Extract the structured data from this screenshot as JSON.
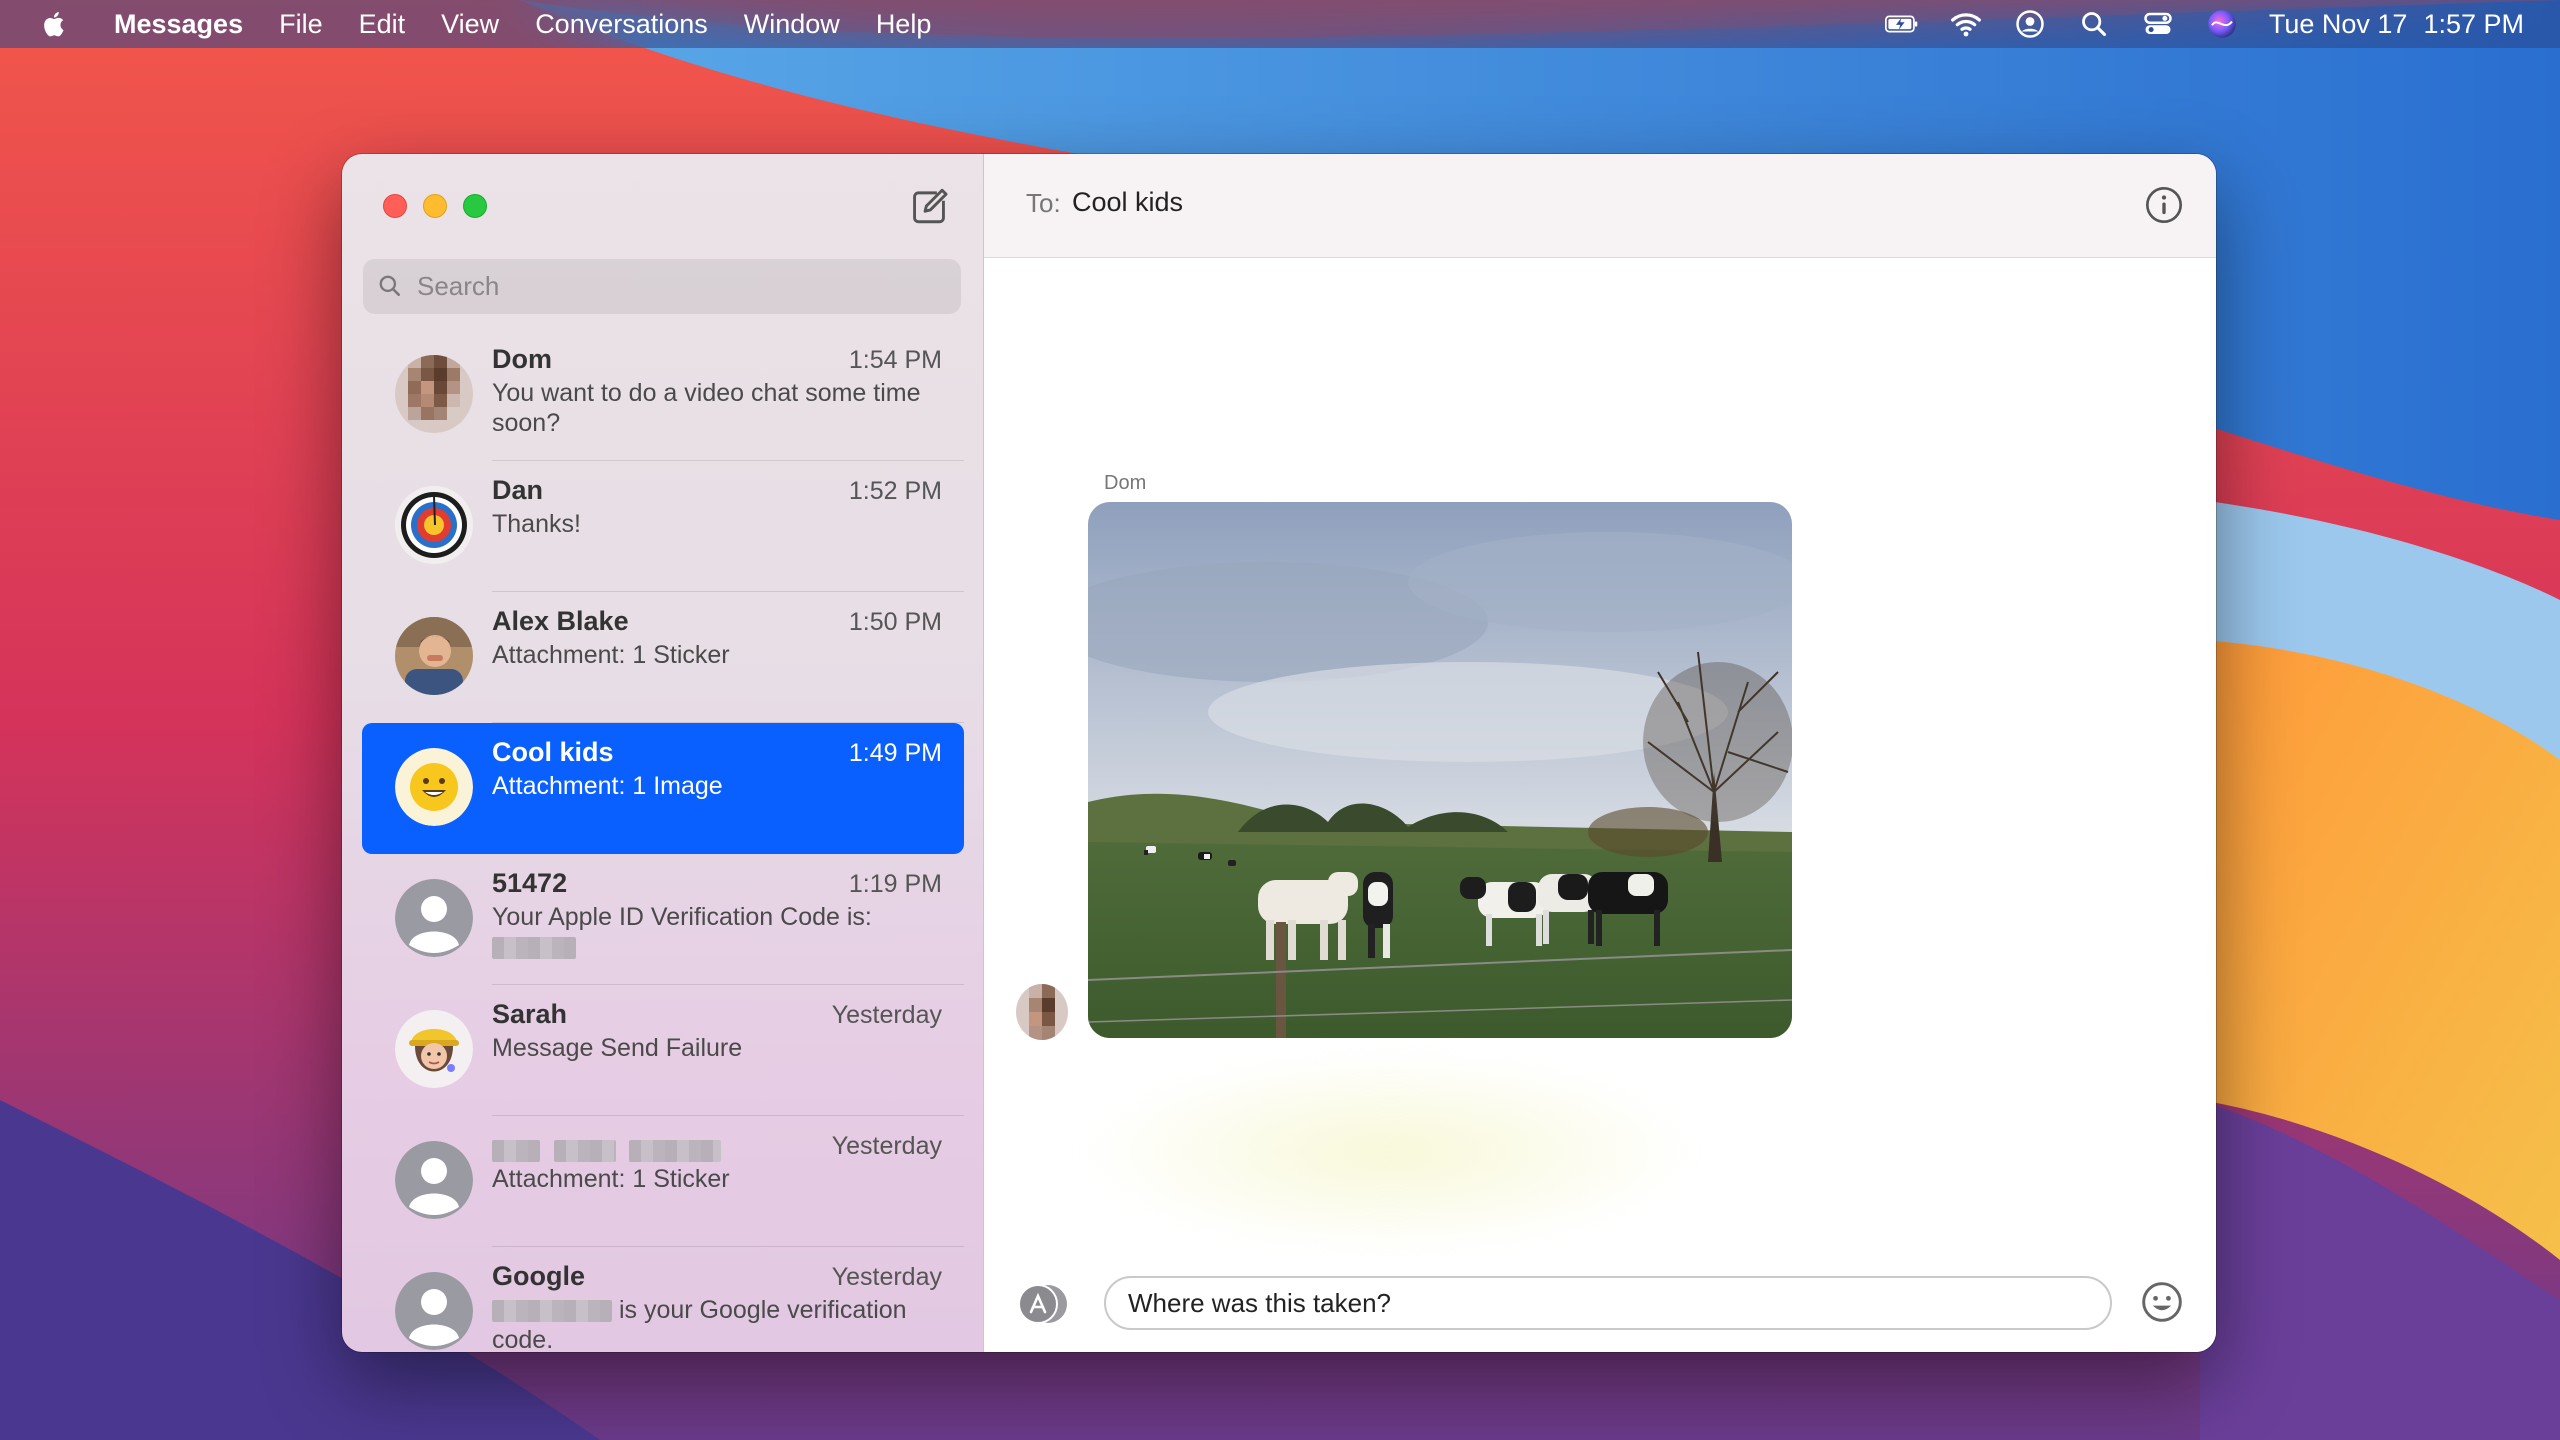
{
  "menubar": {
    "apple_icon": "apple-logo",
    "items": [
      "Messages",
      "File",
      "Edit",
      "View",
      "Conversations",
      "Window",
      "Help"
    ],
    "status_icons": [
      "battery-charging-icon",
      "wifi-icon",
      "user-icon",
      "search-icon",
      "control-center-icon",
      "siri-icon"
    ],
    "date": "Tue Nov 17",
    "time": "1:57 PM"
  },
  "sidebar": {
    "search_placeholder": "Search",
    "conversations": [
      {
        "name": "Dom",
        "time": "1:54 PM",
        "preview": "You want to do a video chat some time soon?",
        "avatar": "photo"
      },
      {
        "name": "Dan",
        "time": "1:52 PM",
        "preview": "Thanks!",
        "avatar": "target"
      },
      {
        "name": "Alex Blake",
        "time": "1:50 PM",
        "preview": "Attachment: 1 Sticker",
        "avatar": "photo"
      },
      {
        "name": "Cool kids",
        "time": "1:49 PM",
        "preview": "Attachment: 1 Image",
        "avatar": "smiley",
        "selected": true
      },
      {
        "name": "51472",
        "time": "1:19 PM",
        "preview": "Your Apple ID Verification Code is:",
        "avatar": "person"
      },
      {
        "name": "Sarah",
        "time": "Yesterday",
        "preview": "Message Send Failure",
        "avatar": "memoji"
      },
      {
        "name": "",
        "time": "Yesterday",
        "preview": "Attachment: 1 Sticker",
        "avatar": "person"
      },
      {
        "name": "Google",
        "time": "Yesterday",
        "preview": "is your Google verification code.",
        "avatar": "person"
      }
    ]
  },
  "chat": {
    "to_label": "To:",
    "to_value": "Cool kids",
    "sender": "Dom",
    "input_value": "Where was this taken?"
  },
  "colors": {
    "accent": "#0a60ff"
  }
}
